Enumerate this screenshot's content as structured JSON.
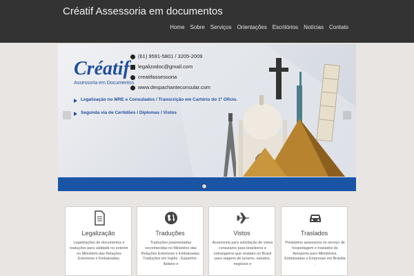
{
  "site": {
    "title": "Créatif Assessoria em documentos"
  },
  "nav": [
    {
      "label": "Home"
    },
    {
      "label": "Sobre"
    },
    {
      "label": "Serviços"
    },
    {
      "label": "Orientações"
    },
    {
      "label": "Escritórios"
    },
    {
      "label": "Notícias"
    },
    {
      "label": "Contato"
    }
  ],
  "banner": {
    "brand": "Créatif",
    "brand_sub": "Assessoria em Documentos",
    "phone": "(61) 9591-5801 / 3205-2009",
    "email": "legalizodoc@gmail.com",
    "skype": "creatifassessoria",
    "web": "www.despachanteconsular.com",
    "line1": "Legalização no MRE e Consulados / Transcrição em Cartório do 1º Ofício.",
    "line2": "Segunda via de Certidões / Diplomas / Vistos"
  },
  "cards": [
    {
      "title": "Legalização",
      "icon": "document-icon",
      "text": "Legalizações de documentos e traduções para validade no exterior no Ministério das Relações Exteriores e Embaixadas."
    },
    {
      "title": "Traduções",
      "icon": "globe-icon",
      "text": "Traduções juramentadas reconhecidas no Ministério das Relações Exteriores e Embaixadas. Traduções em Inglês - Espanhol - Italiano e"
    },
    {
      "title": "Vistos",
      "icon": "airplane-icon",
      "text": "Assessoria para solicitação de vistos consulares para brasileiros e estrangeiros que residam no Brasil para viagens de turismo, estudos, negócios e"
    },
    {
      "title": "Traslados",
      "icon": "car-icon",
      "text": "Prestamos assessoria no serviço de hospedagem e traslados do Aeroporto para Ministérios, Embaixadas e Empresas em Brasília ."
    }
  ],
  "colors": {
    "topbar": "#333333",
    "brand_blue": "#1f4e9e",
    "slider_bar": "#1a55a5",
    "page_bg": "#e9e5e2"
  }
}
